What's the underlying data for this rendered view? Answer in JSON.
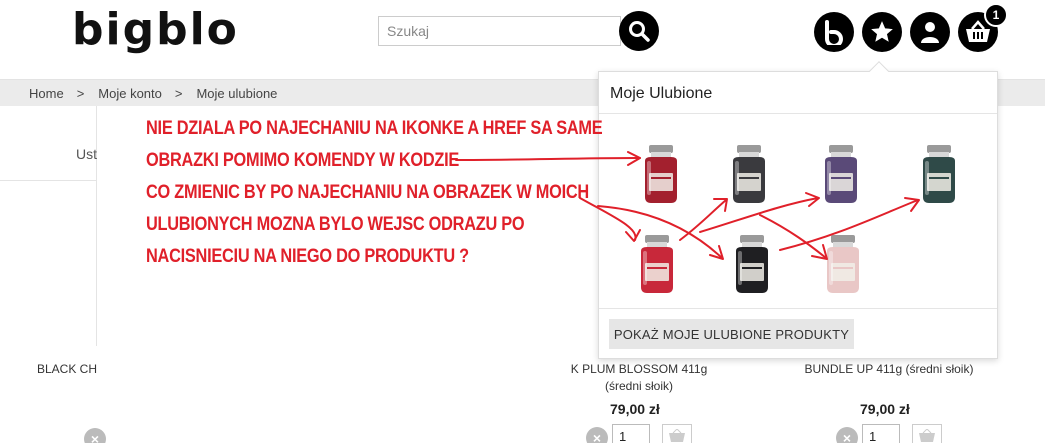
{
  "header": {
    "logo_text": "bigblo",
    "search_placeholder": "Szukaj",
    "cart_count": "1",
    "icons": [
      "search-icon",
      "brand-b-icon",
      "star-icon",
      "user-icon",
      "basket-icon"
    ]
  },
  "breadcrumb": {
    "items": [
      "Home",
      "Moje konto",
      "Moje ulubione"
    ],
    "separator": ">"
  },
  "sidebar": {
    "tab_label": "Ust"
  },
  "favorites_dropdown": {
    "title": "Moje Ulubione",
    "button_label": "POKAŻ MOJE ULUBIONE PRODUKTY",
    "thumb_colors": [
      "#a3202e",
      "#3a3a3e",
      "#5a4a78",
      "#2f4a48",
      "#c8283a",
      "#1f1f22",
      "#e9c7c6"
    ]
  },
  "products": [
    {
      "name_line1": "BLACK CH",
      "name_line2": ""
    },
    {
      "name_line1": "K PLUM BLOSSOM 411g",
      "name_line2": "(średni słoik)",
      "price": "79,00 zł",
      "qty": "1"
    },
    {
      "name_line1": "BUNDLE UP 411g (średni słoik)",
      "name_line2": "",
      "price": "79,00 zł",
      "qty": "1"
    }
  ],
  "annotation": {
    "lines": [
      "NIE DZIALA PO NAJECHANIU NA IKONKE A HREF SA SAME",
      "OBRAZKI POMIMO KOMENDY W KODZIE",
      "CO ZMIENIC BY PO NAJECHANIU NA OBRAZEK W MOICH",
      "ULUBIONYCH MOZNA BYLO WEJSC ODRAZU PO",
      "NACISNIECIU NA NIEGO DO PRODUKTU ?"
    ],
    "color": "#e0202a"
  }
}
